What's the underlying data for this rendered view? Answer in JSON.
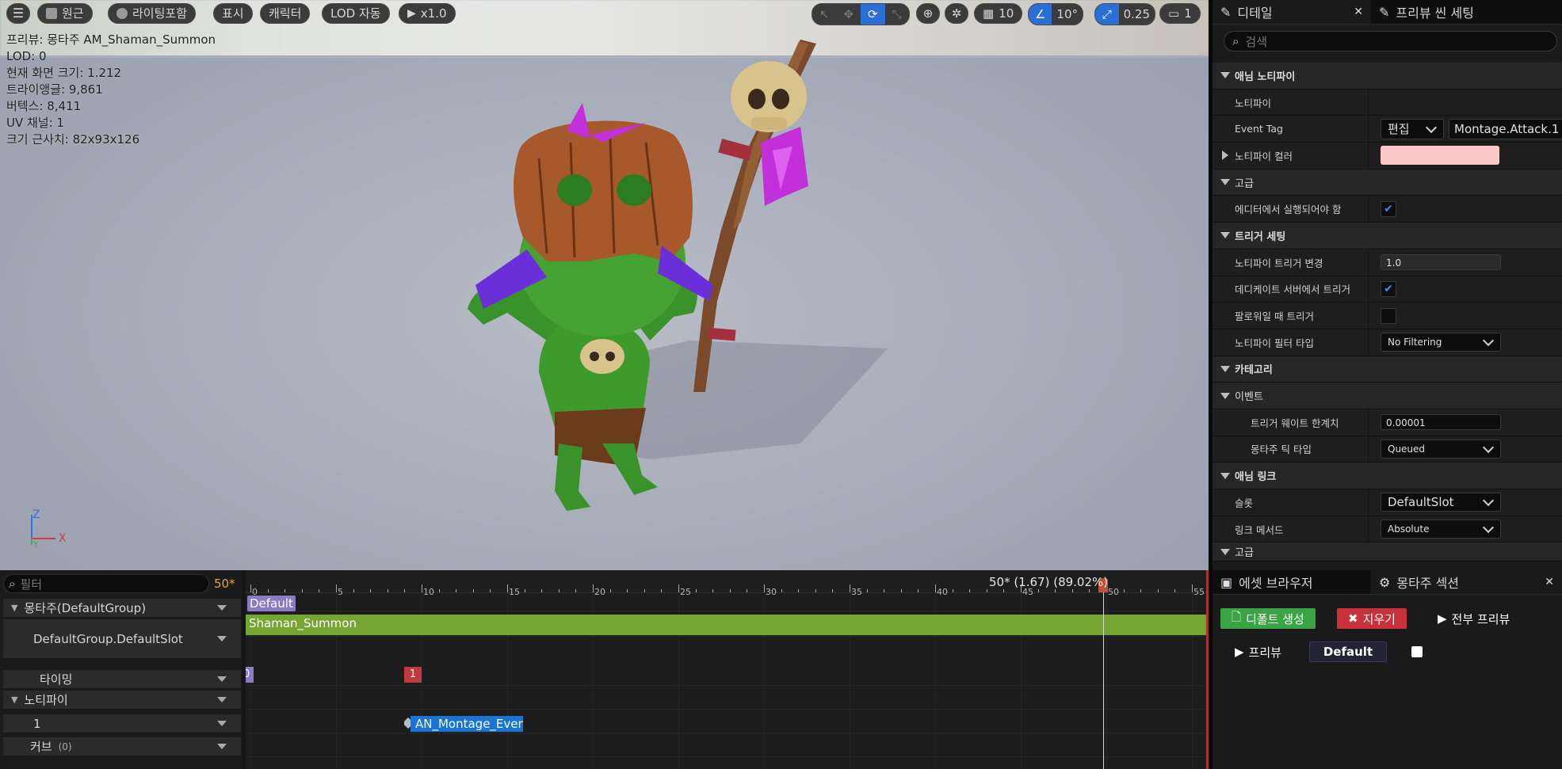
{
  "viewport": {
    "toolbar": {
      "menu_icon": "hamburger-icon",
      "perspective_label": "원근",
      "lighting_label": "라이팅포함",
      "show_label": "표시",
      "character_label": "캐릭터",
      "lod_label": "LOD 자동",
      "play_speed_label": "x1.0",
      "grid_snap_value": "10",
      "rotation_snap_value": "10°",
      "scale_snap_value": "0.25",
      "camera_speed_value": "1"
    },
    "stats": [
      "프리뷰: 몽타주 AM_Shaman_Summon",
      "LOD: 0",
      "현재 화면 크기: 1.212",
      "트라이앵글: 9,861",
      "버텍스: 8,411",
      "UV 채널: 1",
      "크기 근사치: 82x93x126"
    ],
    "axis": {
      "z": "Z",
      "y": "Y",
      "x": "X"
    }
  },
  "details": {
    "tab_details": "디테일",
    "tab_preview": "프리뷰 씬 세팅",
    "search_placeholder": "검색",
    "rows": {
      "anim_notify": "애님 노티파이",
      "notify": "노티파이",
      "event_tag": "Event Tag",
      "event_tag_edit": "편집",
      "event_tag_value": "Montage.Attack.1",
      "notify_color": "노티파이 컬러",
      "advanced": "고급",
      "run_in_editor": "에디터에서 실행되어야 함",
      "trigger_settings": "트리거 세팅",
      "notify_trigger_change": "노티파이 트리거 변경",
      "notify_trigger_change_value": "1.0",
      "dedicated_server_trigger": "데디케이트 서버에서 트리거",
      "follower_trigger": "팔로워일 때 트리거",
      "notify_filter_type": "노티파이 필터 타입",
      "notify_filter_type_value": "No Filtering",
      "category": "카테고리",
      "event": "이벤트",
      "trigger_weight_threshold": "트리거 웨이트 한계치",
      "trigger_weight_threshold_value": "0.00001",
      "montage_tick_type": "몽타주 틱 타입",
      "montage_tick_type_value": "Queued",
      "anim_link": "애님 링크",
      "slot": "슬롯",
      "slot_value": "DefaultSlot",
      "link_method": "링크 메서드",
      "link_method_value": "Absolute",
      "advanced2": "고급"
    },
    "notify_color_hex": "#ffc8c8"
  },
  "timeline": {
    "filter_placeholder": "필터",
    "current_frame": "50*",
    "playhead_label": "50* (1.67) (89.02%)",
    "tracks": {
      "montage_group": "몽타주(DefaultGroup)",
      "slot": "DefaultGroup.DefaultSlot",
      "timing": "타이밍",
      "notifies": "노티파이",
      "notify_track_1": "1",
      "curves": "커브",
      "curves_count": "(0)"
    },
    "ticks": [
      "0",
      "5",
      "10",
      "15",
      "20",
      "25",
      "30",
      "35",
      "40",
      "45",
      "50",
      "55"
    ],
    "section_label": "Default",
    "segment_label": "Shaman_Summon",
    "timing_marker_0": "0",
    "timing_marker_1": "1",
    "notify_label": "AN_Montage_Event"
  },
  "montage_sections": {
    "tab_asset_browser": "에셋 브라우저",
    "tab_montage_sections": "몽타주 섹션",
    "create_default_label": "디폴트 생성",
    "clear_label": "지우기",
    "preview_all_label": "전부 프리뷰",
    "preview_label": "프리뷰",
    "default_section_label": "Default"
  },
  "colors": {
    "accent_blue": "#2a6fd6",
    "segment_green": "#75a532",
    "section_purple": "#8b7bc4",
    "timing_red": "#c0393f",
    "notify_blue": "#1b74d3",
    "frame_orange": "#e6a43a",
    "btn_green": "#3aa343",
    "btn_red": "#c8313a"
  }
}
